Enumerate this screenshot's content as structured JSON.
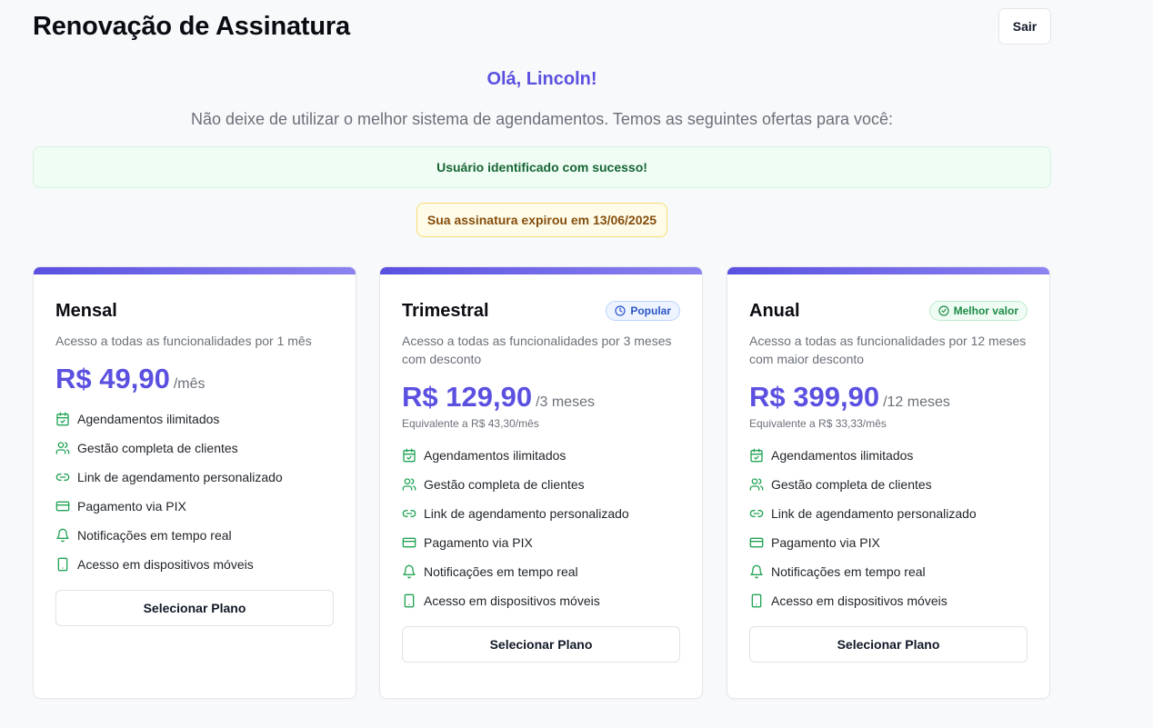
{
  "header": {
    "title": "Renovação de Assinatura",
    "logout_label": "Sair"
  },
  "greeting": "Olá, Lincoln!",
  "subtitle": "Não deixe de utilizar o melhor sistema de agendamentos. Temos as seguintes ofertas para você:",
  "alerts": {
    "success": "Usuário identificado com sucesso!",
    "expired": "Sua assinatura expirou em 13/06/2025"
  },
  "colors": {
    "accent": "#5b50e0",
    "feature_icon": "#22a355",
    "success_bg": "#f0fdf4",
    "warning_bg": "#fefce8"
  },
  "feature_icons": [
    "calendar-check-icon",
    "users-icon",
    "link-icon",
    "credit-card-icon",
    "bell-icon",
    "smartphone-icon"
  ],
  "plans": [
    {
      "name": "Mensal",
      "badge": "",
      "description": "Acesso a todas as funcionalidades por 1 mês",
      "price": "R$ 49,90",
      "period": "/mês",
      "equivalent": "",
      "features": [
        "Agendamentos ilimitados",
        "Gestão completa de clientes",
        "Link de agendamento personalizado",
        "Pagamento via PIX",
        "Notificações em tempo real",
        "Acesso em dispositivos móveis"
      ],
      "button": "Selecionar Plano"
    },
    {
      "name": "Trimestral",
      "badge": "Popular",
      "description": "Acesso a todas as funcionalidades por 3 meses com desconto",
      "price": "R$ 129,90",
      "period": "/3 meses",
      "equivalent": "Equivalente a R$ 43,30/mês",
      "features": [
        "Agendamentos ilimitados",
        "Gestão completa de clientes",
        "Link de agendamento personalizado",
        "Pagamento via PIX",
        "Notificações em tempo real",
        "Acesso em dispositivos móveis"
      ],
      "button": "Selecionar Plano"
    },
    {
      "name": "Anual",
      "badge": "Melhor valor",
      "description": "Acesso a todas as funcionalidades por 12 meses com maior desconto",
      "price": "R$ 399,90",
      "period": "/12 meses",
      "equivalent": "Equivalente a R$ 33,33/mês",
      "features": [
        "Agendamentos ilimitados",
        "Gestão completa de clientes",
        "Link de agendamento personalizado",
        "Pagamento via PIX",
        "Notificações em tempo real",
        "Acesso em dispositivos móveis"
      ],
      "button": "Selecionar Plano"
    }
  ]
}
